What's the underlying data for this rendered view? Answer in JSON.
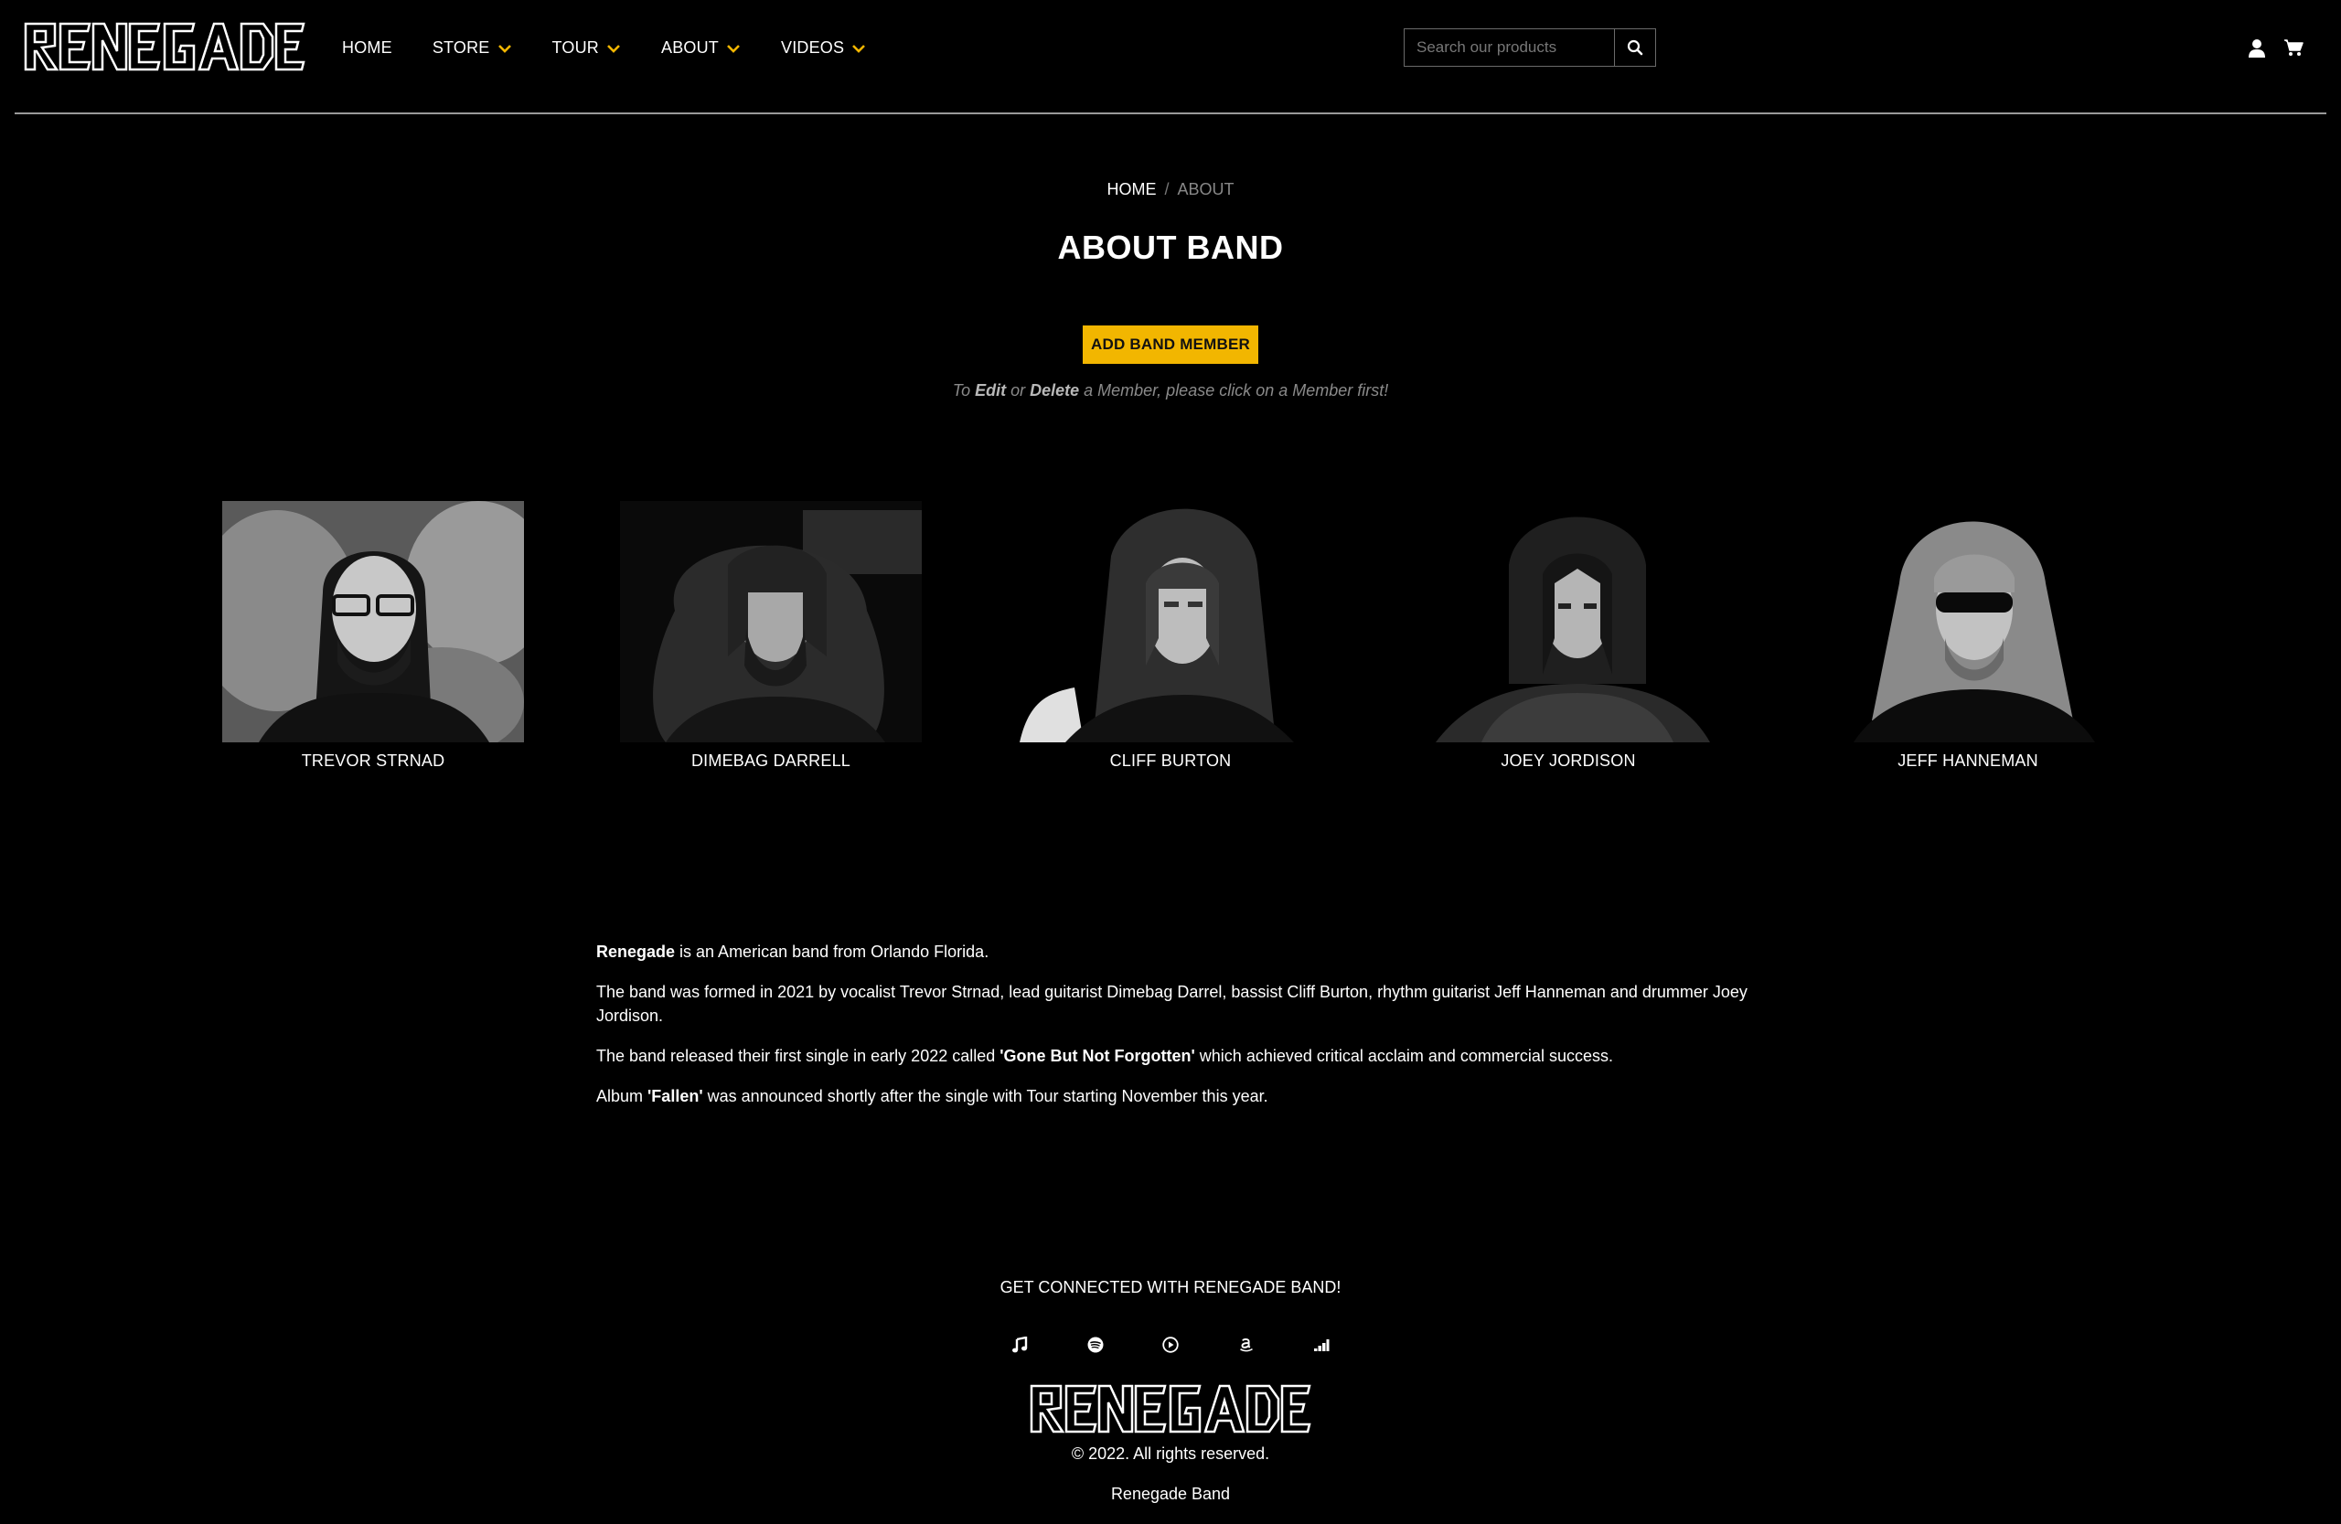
{
  "brand": {
    "logo_text": "RENEGADE",
    "accent_color": "#f2b600"
  },
  "nav": {
    "items": [
      {
        "label": "HOME",
        "dropdown": false
      },
      {
        "label": "STORE",
        "dropdown": true
      },
      {
        "label": "TOUR",
        "dropdown": true
      },
      {
        "label": "ABOUT",
        "dropdown": true
      },
      {
        "label": "VIDEOS",
        "dropdown": true
      }
    ]
  },
  "search": {
    "placeholder": "Search our products",
    "value": ""
  },
  "icons": {
    "search": "search-icon",
    "user": "user-icon",
    "cart": "cart-icon"
  },
  "breadcrumb": {
    "home": "HOME",
    "separator": "/",
    "current": "ABOUT"
  },
  "page": {
    "title": "ABOUT BAND",
    "add_button": "ADD BAND MEMBER",
    "hint": {
      "prefix": "To ",
      "edit": "Edit",
      "middle": " or ",
      "delete": "Delete",
      "suffix": " a Member, please click on a Member first!"
    }
  },
  "members": [
    {
      "name": "TREVOR STRNAD"
    },
    {
      "name": "DIMEBAG DARRELL"
    },
    {
      "name": "CLIFF BURTON"
    },
    {
      "name": "JOEY JORDISON"
    },
    {
      "name": "JEFF HANNEMAN"
    }
  ],
  "about": {
    "p1_bold": "Renegade",
    "p1_rest": " is an American band from Orlando Florida.",
    "p2": "The band was formed in 2021 by vocalist Trevor Strnad, lead guitarist Dimebag Darrel, bassist Cliff Burton, rhythm guitarist Jeff Hanneman and drummer Joey Jordison.",
    "p3_pre": "The band released their first single in early 2022 called ",
    "p3_bold": "'Gone But Not Forgotten'",
    "p3_post": " which achieved critical acclaim and commercial success.",
    "p4_pre": "Album ",
    "p4_bold": "'Fallen'",
    "p4_post": " was announced shortly after the single with Tour starting November this year."
  },
  "footer": {
    "connect": "GET CONNECTED WITH RENEGADE BAND!",
    "socials": [
      "music-note-icon",
      "spotify-icon",
      "play-circle-icon",
      "amazon-icon",
      "deezer-icon"
    ],
    "copyright": "© 2022. All rights reserved.",
    "name": "Renegade Band"
  }
}
